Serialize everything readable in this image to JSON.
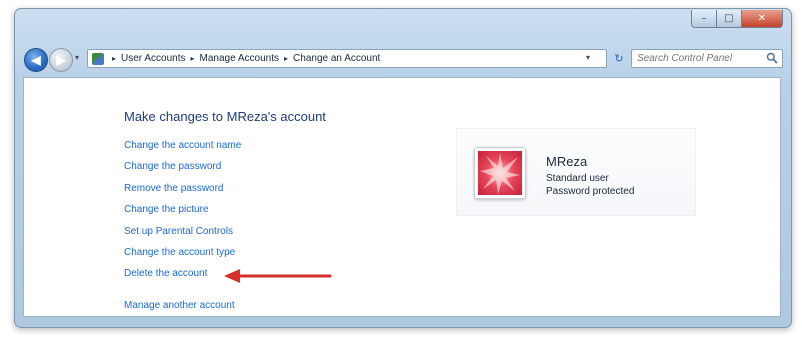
{
  "window": {
    "controls": {
      "minimize": "–",
      "maximize": "□",
      "close": "✕"
    }
  },
  "navigation": {
    "back": "◀",
    "forward": "▶",
    "recent": "▾",
    "breadcrumb": [
      "User Accounts",
      "Manage Accounts",
      "Change an Account"
    ],
    "separator": "▸",
    "refresh": "↻"
  },
  "search": {
    "placeholder": "Search Control Panel"
  },
  "page": {
    "title": "Make changes to MReza's account"
  },
  "tasks": [
    "Change the account name",
    "Change the password",
    "Remove the password",
    "Change the picture",
    "Set up Parental Controls",
    "Change the account type",
    "Delete the account"
  ],
  "manage_other": "Manage another account",
  "account": {
    "name": "MReza",
    "type": "Standard user",
    "password_status": "Password protected"
  },
  "colors": {
    "link": "#1b6ad6",
    "title": "#1e3c7b",
    "arrow": "#d62e2a"
  }
}
